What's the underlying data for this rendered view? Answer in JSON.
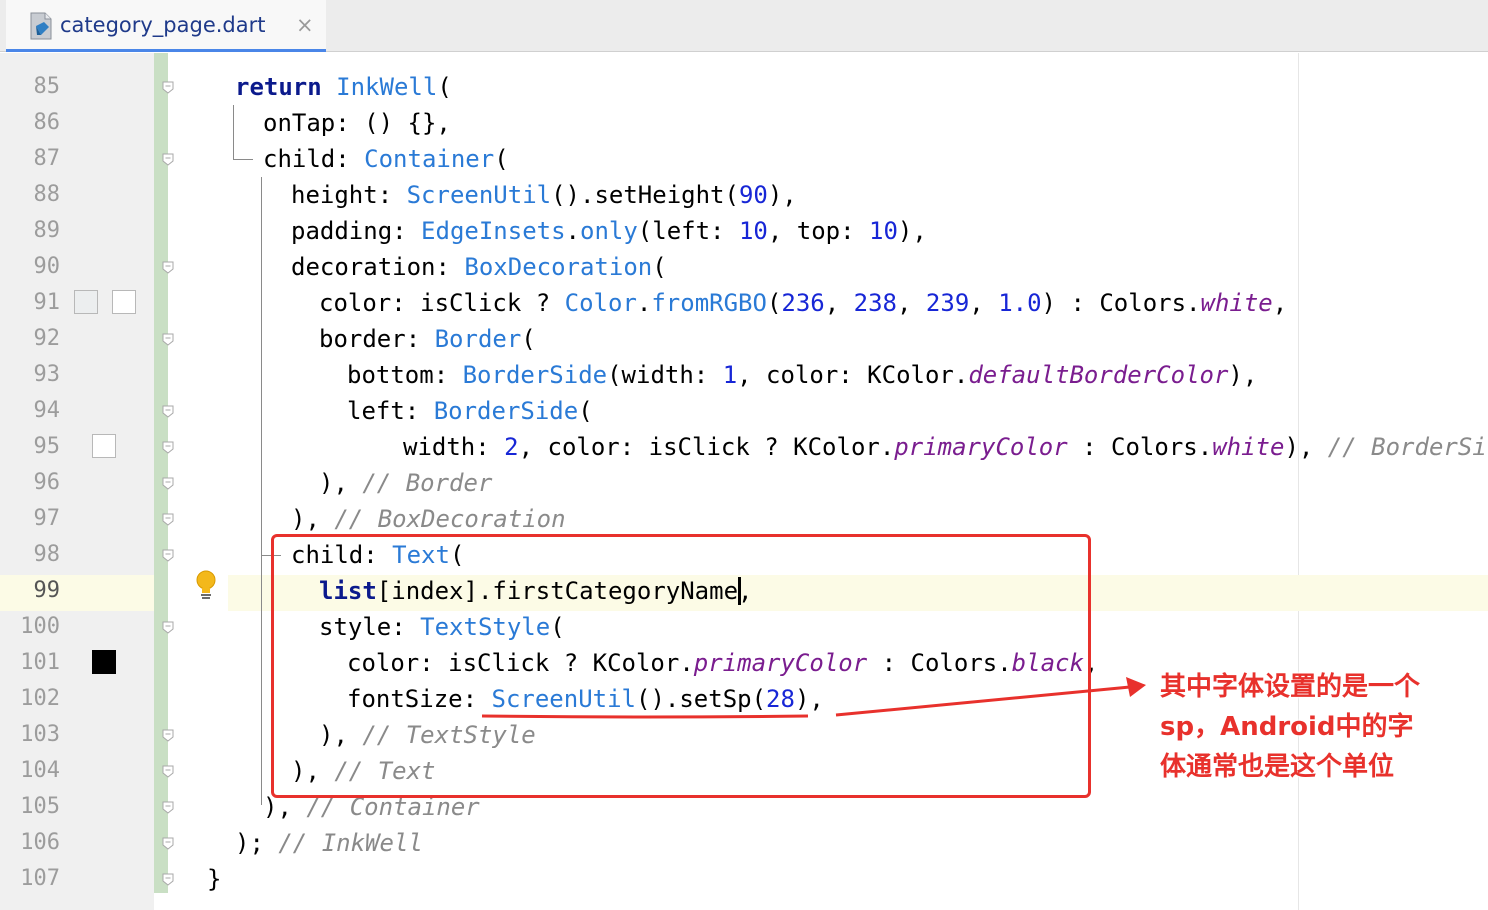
{
  "tab": {
    "filename": "category_page.dart",
    "close_glyph": "×"
  },
  "gutter": {
    "line_numbers": [
      "85",
      "86",
      "87",
      "88",
      "89",
      "90",
      "91",
      "92",
      "93",
      "94",
      "95",
      "96",
      "97",
      "98",
      "99",
      "100",
      "101",
      "102",
      "103",
      "104",
      "105",
      "106",
      "107"
    ],
    "current_line": "99"
  },
  "code": {
    "l85": {
      "kw": "return",
      "cls": "InkWell",
      "p": "("
    },
    "l86": {
      "t": "onTap: () {},"
    },
    "l87": {
      "a": "child: ",
      "cls": "Container",
      "p": "("
    },
    "l88": {
      "a": "height: ",
      "cls": "ScreenUtil",
      "b": "().setHeight(",
      "n": "90",
      "c": "),"
    },
    "l89": {
      "a": "padding: ",
      "cls": "EdgeInsets",
      "dot": ".",
      "m": "only",
      "b": "(left: ",
      "n1": "10",
      "c": ", top: ",
      "n2": "10",
      "d": "),"
    },
    "l90": {
      "a": "decoration: ",
      "cls": "BoxDecoration",
      "p": "("
    },
    "l91": {
      "a": "color: isClick ? ",
      "cls": "Color",
      "dot": ".",
      "m": "fromRGBO",
      "b": "(",
      "n1": "236",
      "s1": ", ",
      "n2": "238",
      "s2": ", ",
      "n3": "239",
      "s3": ", ",
      "n4": "1.0",
      "c": ") : Colors.",
      "f": "white",
      "d": ","
    },
    "l92": {
      "a": "border: ",
      "cls": "Border",
      "p": "("
    },
    "l93": {
      "a": "bottom: ",
      "cls": "BorderSide",
      "b": "(width: ",
      "n": "1",
      "c": ", color: KColor.",
      "f": "defaultBorderColor",
      "d": "),"
    },
    "l94": {
      "a": "left: ",
      "cls": "BorderSide",
      "p": "("
    },
    "l95": {
      "a": "width: ",
      "n": "2",
      "b": ", color: isClick ? KColor.",
      "f1": "primaryColor",
      "c": " : Colors.",
      "f2": "white",
      "d": "), ",
      "cm": "// BorderSide"
    },
    "l96": {
      "a": "), ",
      "cm": "// Border"
    },
    "l97": {
      "a": "), ",
      "cm": "// BoxDecoration"
    },
    "l98": {
      "a": "child: ",
      "cls": "Text",
      "p": "("
    },
    "l99": {
      "kw": "list",
      "b": "[index].firstCategoryName,"
    },
    "l100": {
      "a": "style: ",
      "cls": "TextStyle",
      "p": "("
    },
    "l101": {
      "a": "color: isClick ? KColor.",
      "f1": "primaryColor",
      "b": " : Colors.",
      "f2": "black",
      "c": ","
    },
    "l102": {
      "a": "fontSize: ",
      "cls": "ScreenUtil",
      "b": "().setSp(",
      "n": "28",
      "c": "),"
    },
    "l103": {
      "a": "), ",
      "cm": "// TextStyle"
    },
    "l104": {
      "a": "), ",
      "cm": "// Text"
    },
    "l105": {
      "a": "), ",
      "cm": "// Container"
    },
    "l106": {
      "a": "); ",
      "cm": "// InkWell"
    },
    "l107": {
      "t": "}"
    }
  },
  "annotation": {
    "lines": [
      "其中字体设置的是一个",
      "sp，Android中的字",
      "体通常也是这个单位"
    ]
  },
  "colors": {
    "keyword": "#0b1a8c",
    "class": "#2a7ad6",
    "number": "#1726d6",
    "comment": "#8a8a8a",
    "field": "#7a1d8f",
    "highlight_line": "#fcfbe6",
    "annotation_red": "#e8312c",
    "swatch_91_a": "#ecee ef",
    "swatch_101": "#000000"
  },
  "icons": [
    "dart-file-icon",
    "close-icon",
    "fold-marker-icon",
    "intention-bulb-icon",
    "color-swatch-icon"
  ]
}
